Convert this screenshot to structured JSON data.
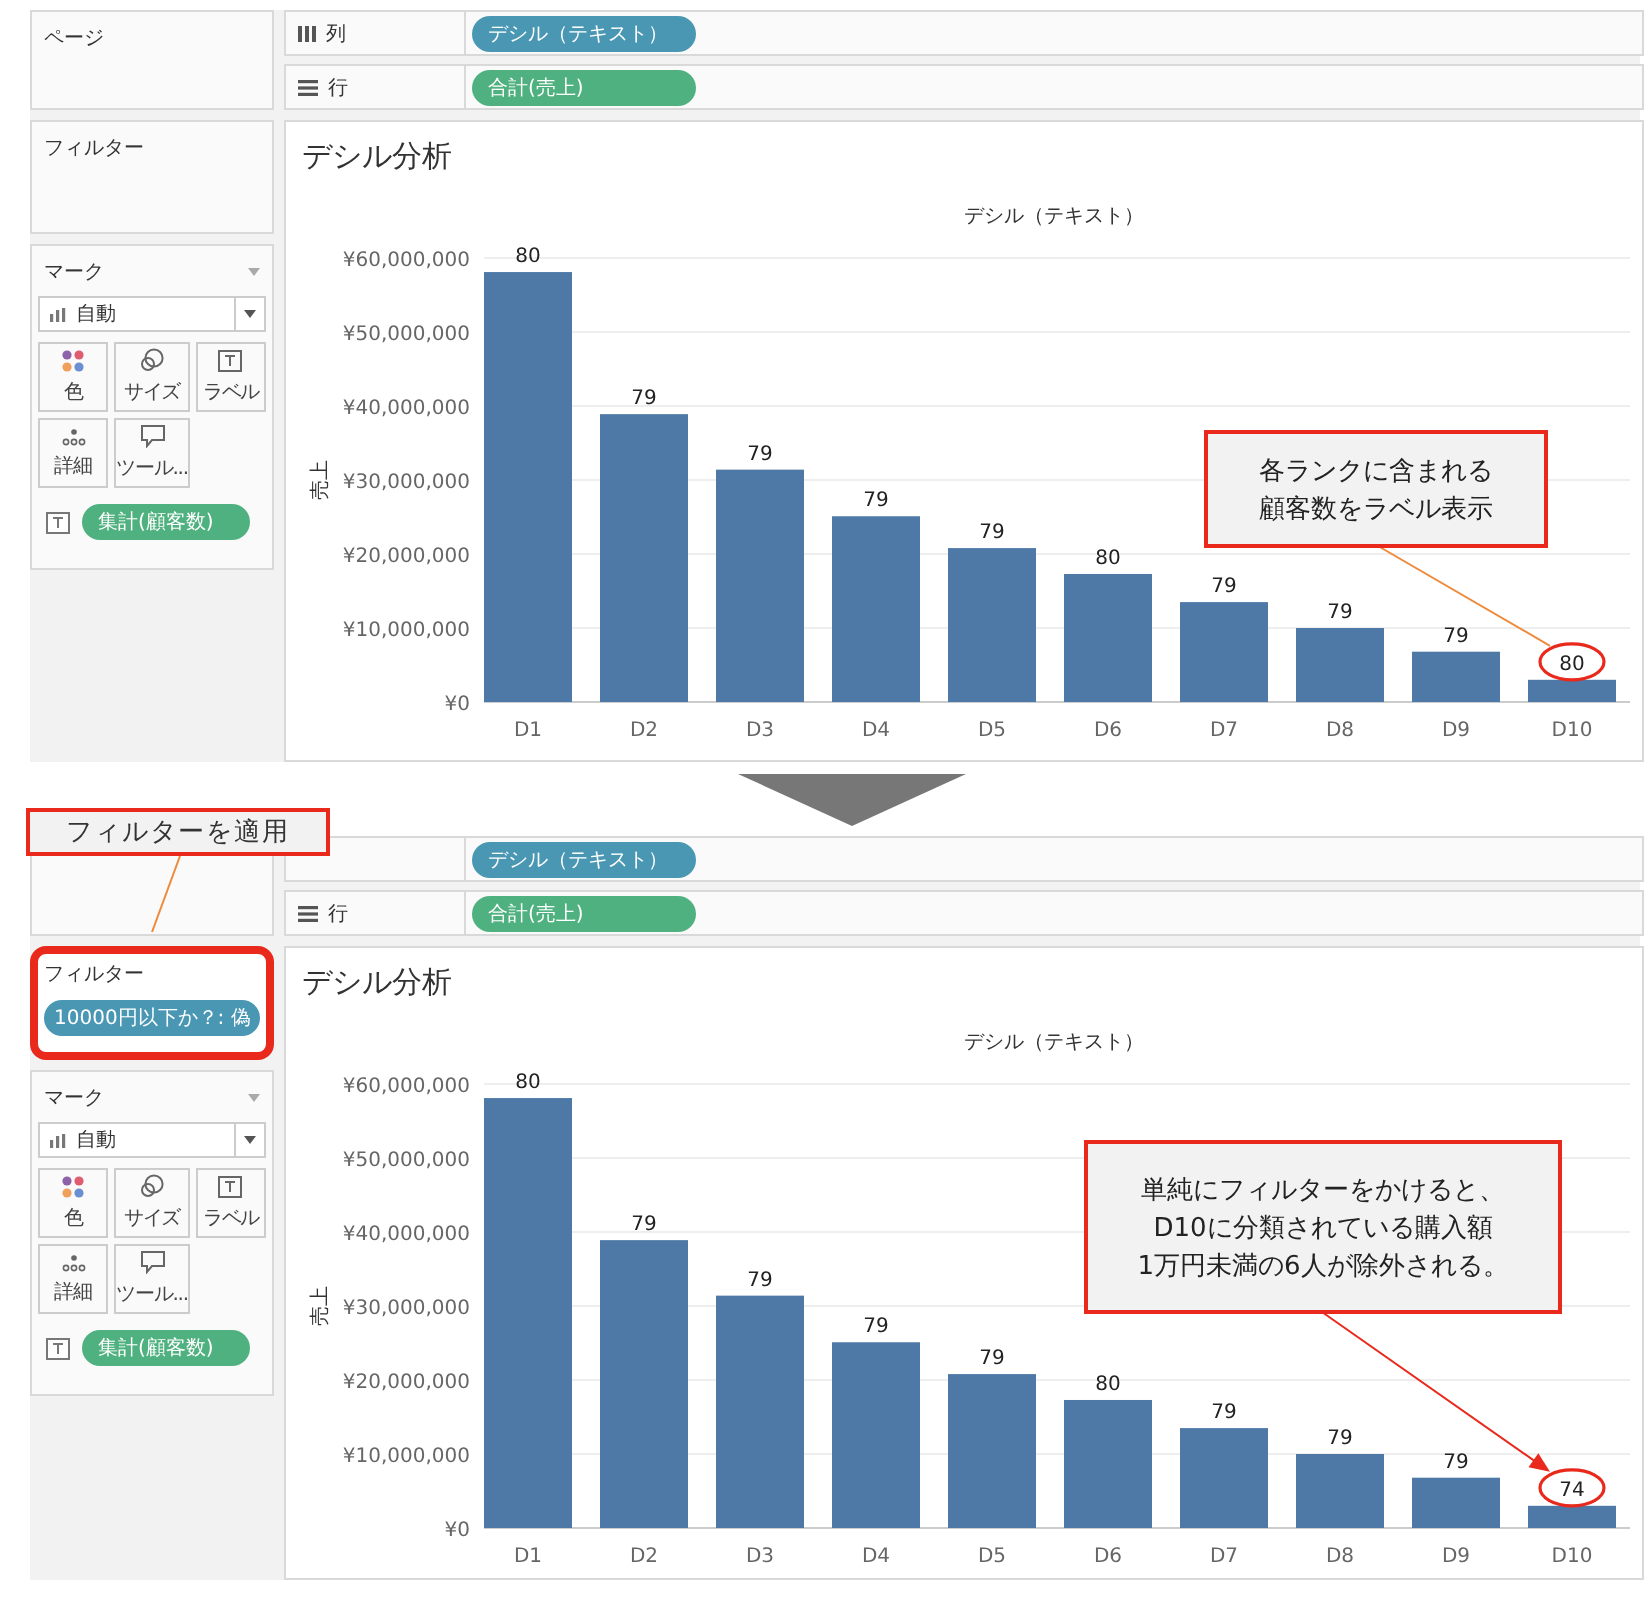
{
  "panels": [
    {
      "shelves": {
        "pages_label": "ページ",
        "columns": {
          "label": "列",
          "pill": "デシル（テキスト）"
        },
        "rows": {
          "label": "行",
          "pill": "合計(売上)"
        }
      },
      "filters": {
        "label": "フィルター",
        "highlighted": false
      },
      "marks": {
        "label": "マーク",
        "type": "自動",
        "buttons": [
          {
            "kind": "color",
            "label": "色"
          },
          {
            "kind": "size",
            "label": "サイズ"
          },
          {
            "kind": "label",
            "label": "ラベル"
          },
          {
            "kind": "detail",
            "label": "詳細"
          },
          {
            "kind": "tooltip",
            "label": "ツール..."
          }
        ],
        "pill": "集計(顧客数)"
      },
      "sheet": {
        "title": "デシル分析",
        "chart_data": {
          "type": "bar",
          "title": "デシル（テキスト）",
          "ylabel": "売上",
          "categories": [
            "D1",
            "D2",
            "D3",
            "D4",
            "D5",
            "D6",
            "D7",
            "D8",
            "D9",
            "D10"
          ],
          "values": [
            58100000,
            38900000,
            31400000,
            25100000,
            20800000,
            17300000,
            13500000,
            10000000,
            6800000,
            3000000
          ],
          "annotations": [
            "80",
            "79",
            "79",
            "79",
            "79",
            "80",
            "79",
            "79",
            "79",
            "80"
          ],
          "grid": true,
          "ylim": [
            0,
            60000000
          ],
          "yticks": [
            {
              "value": 0,
              "label": "¥0"
            },
            {
              "value": 10000000,
              "label": "¥10,000,000"
            },
            {
              "value": 20000000,
              "label": "¥20,000,000"
            },
            {
              "value": 30000000,
              "label": "¥30,000,000"
            },
            {
              "value": 40000000,
              "label": "¥40,000,000"
            },
            {
              "value": 50000000,
              "label": "¥50,000,000"
            },
            {
              "value": 60000000,
              "label": "¥60,000,000"
            }
          ]
        }
      },
      "callouts": [
        {
          "kind": "chart",
          "lines": [
            "各ランクに含まれる",
            "顧客数をラベル表示"
          ],
          "arrowhead": false
        }
      ]
    },
    {
      "shelves": {
        "columns": {
          "pill": "デシル（テキスト）"
        },
        "rows": {
          "label": "行",
          "pill": "合計(売上)"
        }
      },
      "filters": {
        "label": "フィルター",
        "highlighted": true,
        "pill": "10000円以下か？: 偽"
      },
      "marks": {
        "label": "マーク",
        "type": "自動",
        "buttons": [
          {
            "kind": "color",
            "label": "色"
          },
          {
            "kind": "size",
            "label": "サイズ"
          },
          {
            "kind": "label",
            "label": "ラベル"
          },
          {
            "kind": "detail",
            "label": "詳細"
          },
          {
            "kind": "tooltip",
            "label": "ツール..."
          }
        ],
        "pill": "集計(顧客数)"
      },
      "sheet": {
        "title": "デシル分析",
        "chart_data": {
          "type": "bar",
          "title": "デシル（テキスト）",
          "ylabel": "売上",
          "categories": [
            "D1",
            "D2",
            "D3",
            "D4",
            "D5",
            "D6",
            "D7",
            "D8",
            "D9",
            "D10"
          ],
          "values": [
            58100000,
            38900000,
            31400000,
            25100000,
            20800000,
            17300000,
            13500000,
            10000000,
            6800000,
            3000000
          ],
          "annotations": [
            "80",
            "79",
            "79",
            "79",
            "79",
            "80",
            "79",
            "79",
            "79",
            "74"
          ],
          "grid": true,
          "ylim": [
            0,
            60000000
          ],
          "yticks": [
            {
              "value": 0,
              "label": "¥0"
            },
            {
              "value": 10000000,
              "label": "¥10,000,000"
            },
            {
              "value": 20000000,
              "label": "¥20,000,000"
            },
            {
              "value": 30000000,
              "label": "¥30,000,000"
            },
            {
              "value": 40000000,
              "label": "¥40,000,000"
            },
            {
              "value": 50000000,
              "label": "¥50,000,000"
            },
            {
              "value": 60000000,
              "label": "¥60,000,000"
            }
          ]
        }
      },
      "callouts": [
        {
          "kind": "filter",
          "lines": [
            "フィルターを適用"
          ]
        },
        {
          "kind": "chart",
          "lines": [
            "単純にフィルターをかけると、",
            "D10に分類されている購入額",
            "1万円未満の6人が除外される。"
          ],
          "arrowhead": true
        }
      ]
    }
  ]
}
